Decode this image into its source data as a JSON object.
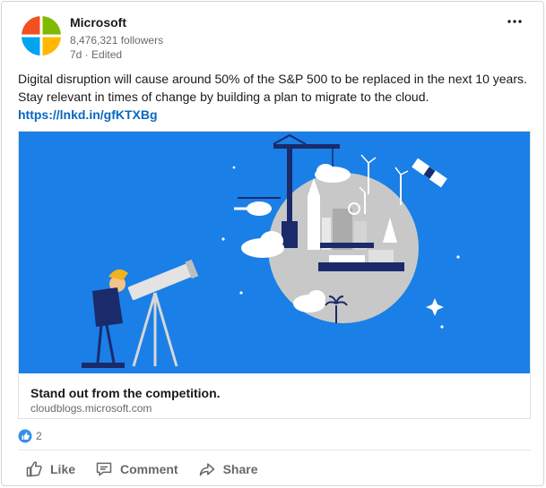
{
  "post": {
    "author": {
      "name": "Microsoft",
      "followers": "8,476,321 followers",
      "meta": "7d · Edited"
    },
    "commentary_text": "Digital disruption will cause around 50% of the S&P 500 to be replaced in the next 10 years. Stay relevant in times of change by building a plan to migrate to the cloud. ",
    "commentary_link": "https://lnkd.in/gfKTXBg",
    "article": {
      "title": "Stand out from the competition.",
      "source": "cloudblogs.microsoft.com"
    },
    "reactions": {
      "count": "2",
      "type_icon": "like-icon"
    }
  },
  "actions": {
    "like": "Like",
    "comment": "Comment",
    "share": "Share"
  },
  "colors": {
    "hero_bg": "#1a7fe6",
    "link": "#0a66c2",
    "logo_red": "#f25022",
    "logo_green": "#7fba00",
    "logo_blue": "#00a4ef",
    "logo_yellow": "#ffb900"
  }
}
